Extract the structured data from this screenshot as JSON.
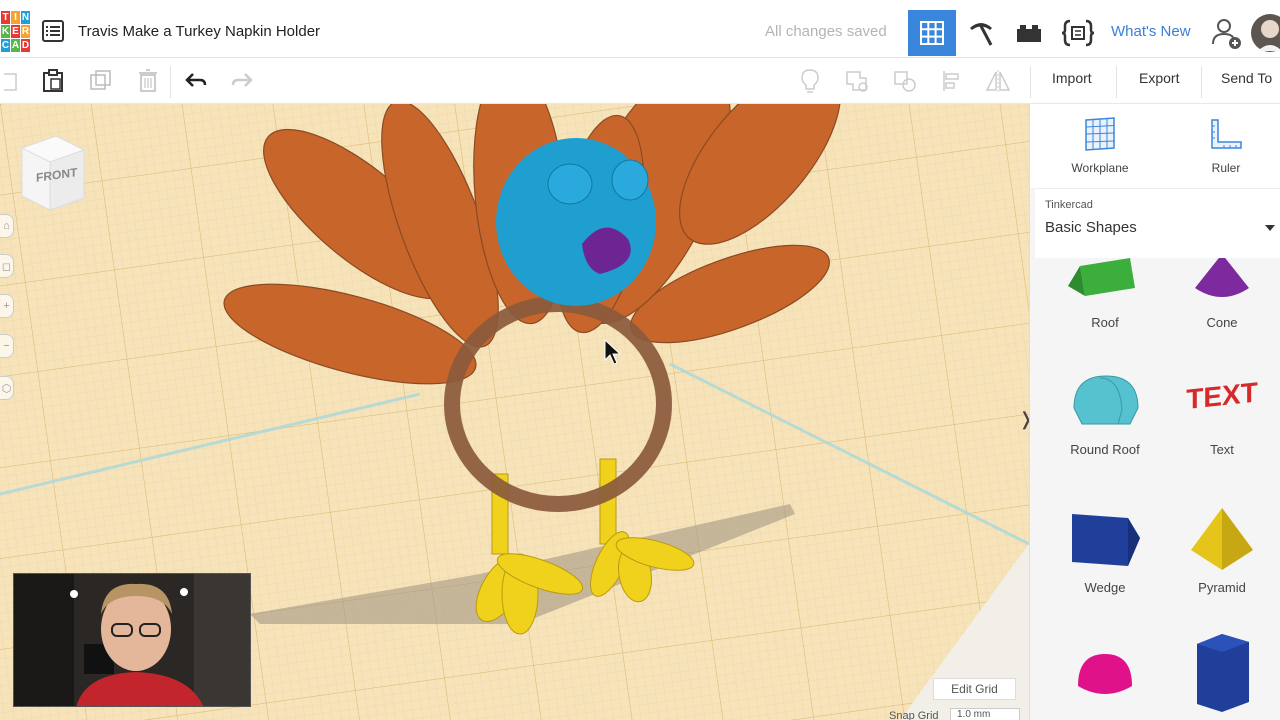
{
  "header": {
    "logo_letters": [
      "T",
      "I",
      "N",
      "K",
      "E",
      "R",
      "C",
      "A",
      "D"
    ],
    "logo_colors": [
      "#e53935",
      "#f4a230",
      "#1f9fd8",
      "#58b847",
      "#e53935",
      "#f4a230",
      "#1f9fd8",
      "#58b847",
      "#e53935"
    ],
    "project_title": "Travis Make a Turkey Napkin Holder",
    "save_status": "All changes saved",
    "whats_new_label": "What's New"
  },
  "toolbar": {
    "import_label": "Import",
    "export_label": "Export",
    "send_to_label": "Send To"
  },
  "viewport": {
    "view_cube_label": "FRONT",
    "edit_grid_label": "Edit Grid",
    "snap_grid_label": "Snap Grid",
    "snap_grid_value": "1.0 mm"
  },
  "panel": {
    "workplane_label": "Workplane",
    "ruler_label": "Ruler",
    "library_category": "Tinkercad",
    "library_value": "Basic Shapes",
    "shapes": [
      {
        "label": "Roof",
        "color": "#3cae3c"
      },
      {
        "label": "Cone",
        "color": "#7c2a9e"
      },
      {
        "label": "Round Roof",
        "color": "#56c1cf"
      },
      {
        "label": "Text",
        "color": "#d62a2a"
      },
      {
        "label": "Wedge",
        "color": "#1f3f9a"
      },
      {
        "label": "Pyramid",
        "color": "#e5c51a"
      },
      {
        "label": "",
        "color": "#e0128a"
      },
      {
        "label": "",
        "color": "#1f3f9a"
      }
    ]
  },
  "colors": {
    "accent": "#3b86dd",
    "feathers": "#c8652a",
    "head": "#1f9ed0",
    "beak": "#6c2592",
    "ring": "#8a5a3c",
    "legs": "#f0d21c"
  }
}
